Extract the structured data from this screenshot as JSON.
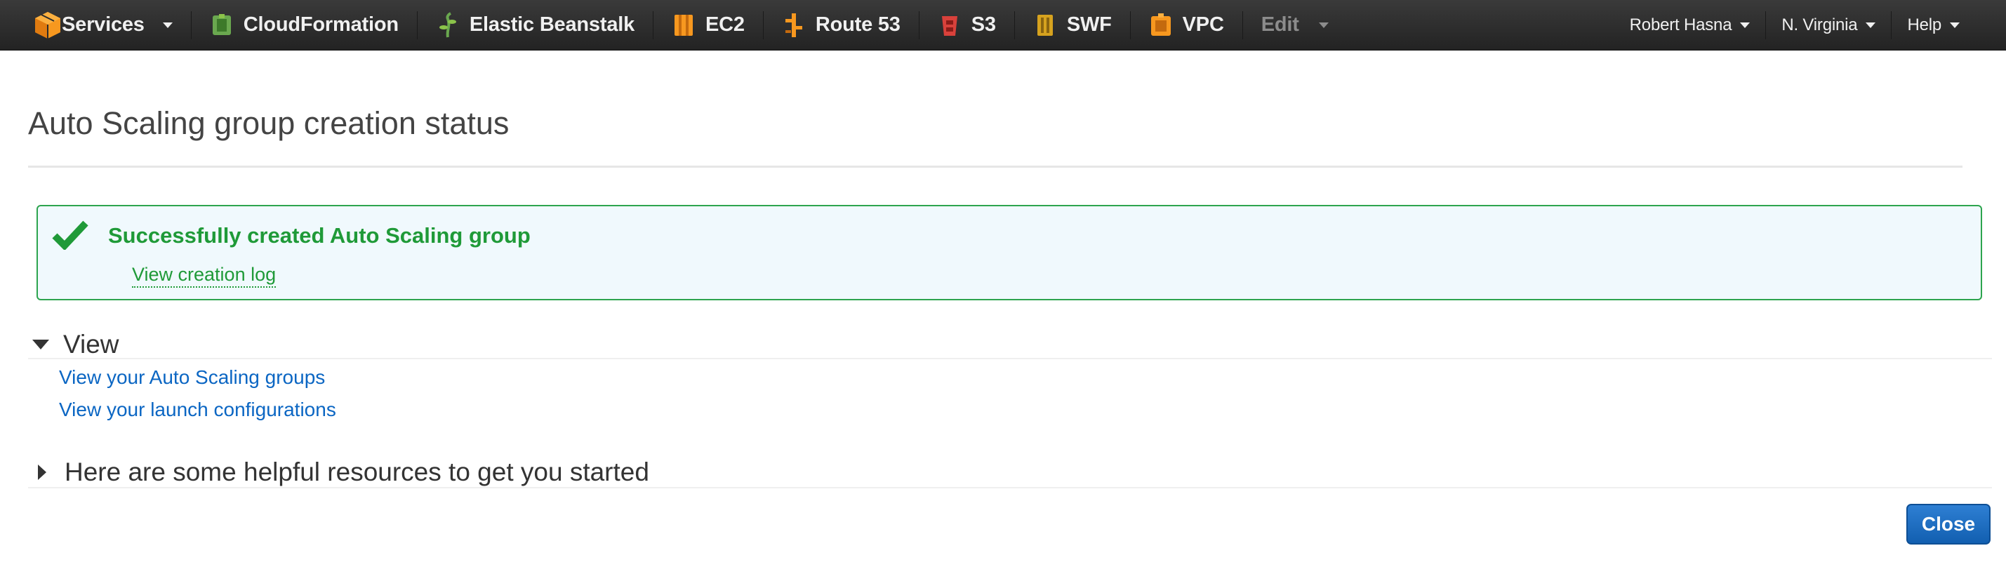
{
  "nav": {
    "services_label": "Services",
    "items": [
      {
        "label": "CloudFormation",
        "icon": "cloudformation-icon"
      },
      {
        "label": "Elastic Beanstalk",
        "icon": "elastic-beanstalk-icon"
      },
      {
        "label": "EC2",
        "icon": "ec2-icon"
      },
      {
        "label": "Route 53",
        "icon": "route53-icon"
      },
      {
        "label": "S3",
        "icon": "s3-icon"
      },
      {
        "label": "SWF",
        "icon": "swf-icon"
      },
      {
        "label": "VPC",
        "icon": "vpc-icon"
      }
    ],
    "edit_label": "Edit",
    "user_label": "Robert Hasna",
    "region_label": "N. Virginia",
    "help_label": "Help"
  },
  "page": {
    "title": "Auto Scaling group creation status"
  },
  "success": {
    "message": "Successfully created Auto Scaling group",
    "link": "View creation log"
  },
  "view_section": {
    "heading": "View",
    "links": [
      "View your Auto Scaling groups",
      "View your launch configurations"
    ]
  },
  "resources_section": {
    "heading": "Here are some helpful resources to get you started"
  },
  "close_label": "Close",
  "colors": {
    "success_green": "#1f9a38",
    "link_blue": "#0b66c3",
    "button_blue": "#1a6fc4",
    "nav_bg": "#2b2b2b",
    "aws_orange": "#f7981f"
  }
}
